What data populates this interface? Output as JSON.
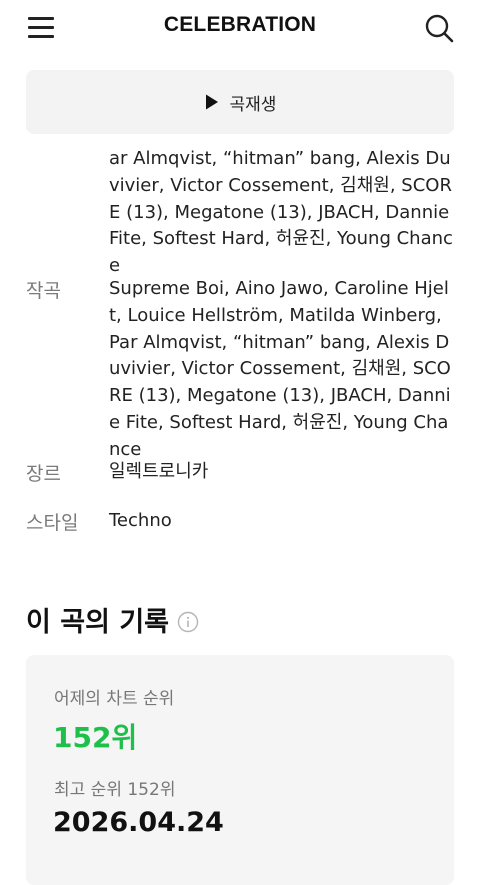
{
  "header": {
    "title": "CELEBRATION",
    "menu_icon": "hamburger-menu-icon",
    "search_icon": "search-icon"
  },
  "play": {
    "label": "곡재생",
    "icon": "play-icon"
  },
  "lyricist_continued": {
    "value": "ar Almqvist, “hitman” bang, Alexis Duvivier, Victor Cossement, 김채원, SCORE (13), Megatone (13), JBACH, Dannie Fite, Softest Hard, 허윤진, Young Chance"
  },
  "composer": {
    "label": "작곡",
    "value": "Supreme Boi, Aino Jawo, Caroline Hjelt, Louice Hellström, Matilda Winberg, Par Almqvist, “hitman” bang, Alexis Duvivier, Victor Cossement, 김채원, SCORE (13), Megatone (13), JBACH, Dannie Fite, Softest Hard, 허윤진, Young Chance"
  },
  "genre": {
    "label": "장르",
    "value": "일렉트로니카"
  },
  "style": {
    "label": "스타일",
    "value": "Techno"
  },
  "record": {
    "title": "이 곡의 기록",
    "info_icon": "info-icon",
    "yesterday_label": "어제의 차트 순위",
    "yesterday_rank": "152위",
    "best_label": "최고 순위 152위",
    "best_date": "2026.04.24"
  },
  "colors": {
    "accent_green": "#1ec04a",
    "label_gray": "#7a7a7a",
    "card_bg": "#f5f5f5"
  }
}
